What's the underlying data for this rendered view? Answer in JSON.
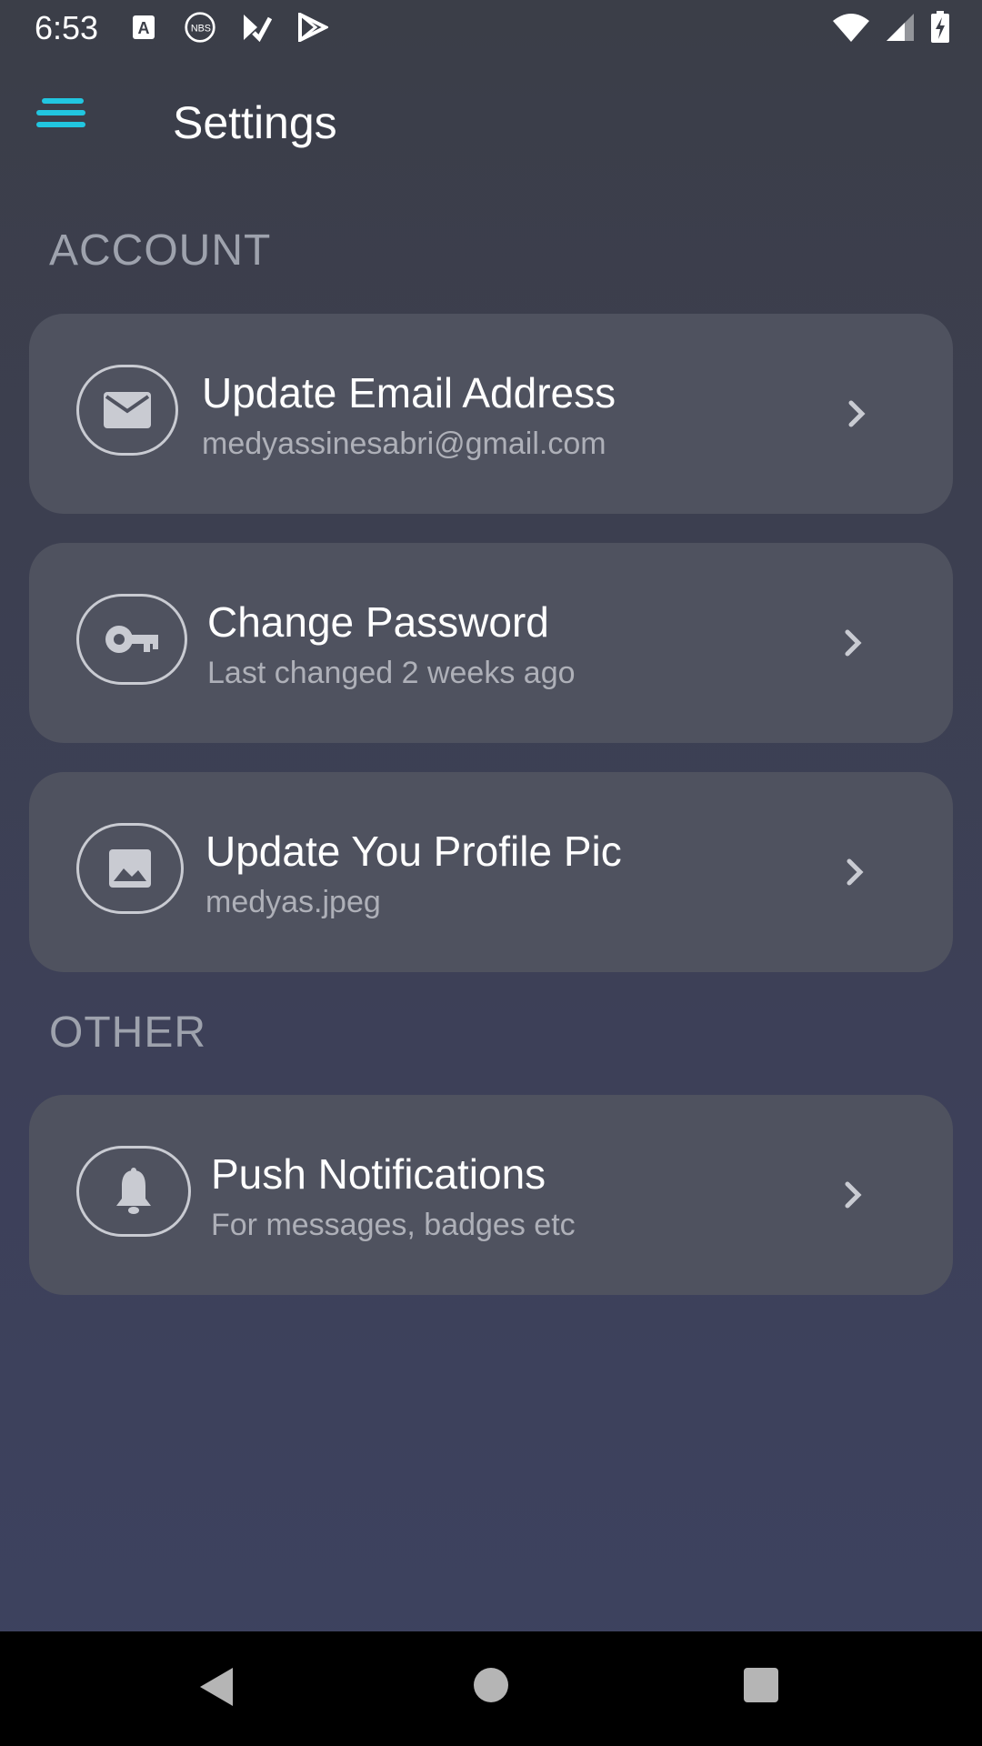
{
  "status_bar": {
    "time": "6:53",
    "left_icons": [
      "font-a-icon",
      "nbs-icon",
      "play-store-check-icon",
      "play-store-icon"
    ],
    "right_icons": [
      "wifi-icon",
      "cell-signal-icon",
      "battery-charging-icon"
    ]
  },
  "header": {
    "title": "Settings",
    "menu_icon": "hamburger-menu-icon",
    "accent": "#21c6e0"
  },
  "sections": {
    "account": {
      "label": "ACCOUNT",
      "items": [
        {
          "title": "Update Email Address",
          "subtitle": "medyassinesabri@gmail.com",
          "icon": "envelope-icon"
        },
        {
          "title": "Change Password",
          "subtitle": "Last changed 2 weeks ago",
          "icon": "key-icon"
        },
        {
          "title": "Update You Profile Pic",
          "subtitle": "medyas.jpeg",
          "icon": "image-icon"
        }
      ]
    },
    "other": {
      "label": "OTHER",
      "items": [
        {
          "title": "Push Notifications",
          "subtitle": "For messages, badges etc",
          "icon": "bell-icon"
        }
      ]
    }
  },
  "nav_bar": {
    "buttons": [
      "back-triangle-icon",
      "home-circle-icon",
      "recents-square-icon"
    ]
  }
}
